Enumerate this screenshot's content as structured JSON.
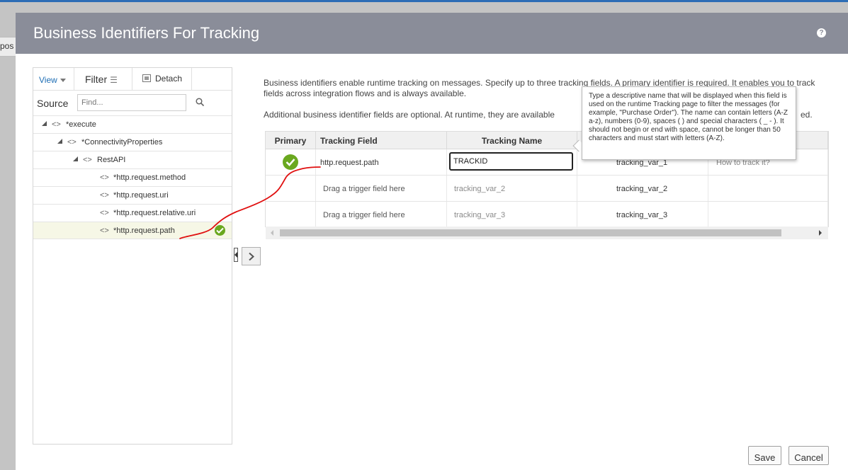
{
  "background": {
    "partial_label": "pos"
  },
  "dialog": {
    "title": "Business Identifiers For Tracking",
    "help_icon": "help-circle-icon"
  },
  "left_panel": {
    "toolbar": {
      "view_label": "View",
      "filter_label": "Filter",
      "detach_label": "Detach"
    },
    "source_label": "Source",
    "search_placeholder": "Find...",
    "tree": [
      {
        "label": "*execute",
        "level": 0,
        "expanded": true
      },
      {
        "label": "*ConnectivityProperties",
        "level": 1,
        "expanded": true
      },
      {
        "label": "RestAPI",
        "level": 2,
        "expanded": true
      },
      {
        "label": "*http.request.method",
        "level": 3
      },
      {
        "label": "*http.request.uri",
        "level": 3
      },
      {
        "label": "*http.request.relative.uri",
        "level": 3
      },
      {
        "label": "*http.request.path",
        "level": 3,
        "selected": true,
        "mapped": true
      }
    ]
  },
  "main": {
    "description_1": "Business identifiers enable runtime tracking on messages. Specify up to three tracking fields. A primary identifier is required. It enables you to track fields across integration flows and is always available.",
    "description_2": "Additional business identifier fields are optional. At runtime, they are available",
    "description_2_tail": "ed.",
    "grid": {
      "columns": [
        "Primary",
        "Tracking Field",
        "Tracking Name",
        "",
        ""
      ],
      "rows": [
        {
          "primary": true,
          "tracking_field": "http.request.path",
          "tracking_name": "TRACKID",
          "col4": "tracking_var_1",
          "col5": "How to track it?"
        },
        {
          "primary": false,
          "tracking_field": "Drag a trigger field here",
          "tracking_name": "tracking_var_2",
          "col4": "tracking_var_2",
          "col5": ""
        },
        {
          "primary": false,
          "tracking_field": "Drag a trigger field here",
          "tracking_name": "tracking_var_3",
          "col4": "tracking_var_3",
          "col5": ""
        }
      ]
    },
    "tooltip": "Type a descriptive name that will be displayed when this field is used on the runtime Tracking page to filter the messages (for example, \"Purchase Order\"). The name can contain letters (A-Z a-z), numbers (0-9), spaces ( ) and special characters ( _ - ). It should not begin or end with space, cannot be longer than 50 characters and must start with letters (A-Z)."
  },
  "footer": {
    "save_label": "Save",
    "cancel_label": "Cancel"
  },
  "colors": {
    "header": "#8a8d99",
    "accent": "#1f6fb5",
    "success": "#6aa81f",
    "annotation": "#e01010"
  }
}
